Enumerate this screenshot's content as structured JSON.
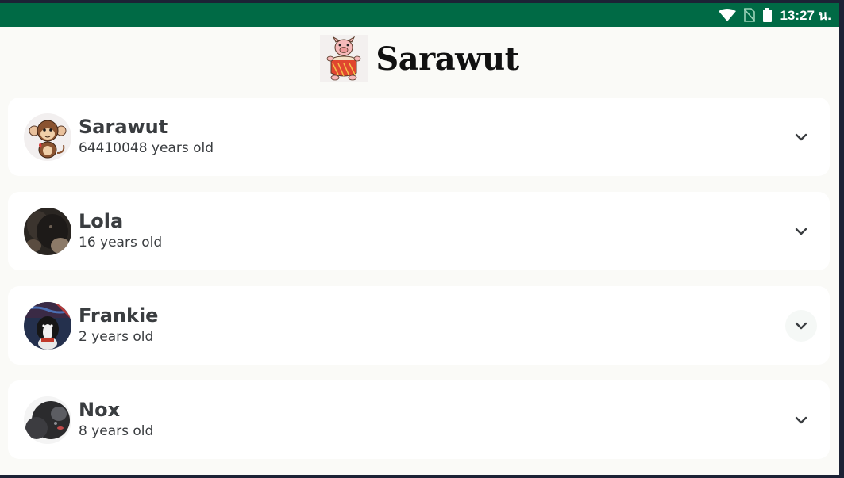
{
  "status_bar": {
    "time": "13:27 น.",
    "icons": [
      "wifi-icon",
      "no-sim-icon",
      "battery-icon"
    ]
  },
  "header": {
    "title": "Sarawut",
    "logo": "pig-drum-logo"
  },
  "pets": [
    {
      "name": "Sarawut",
      "age": "64410048 years old",
      "avatar": "monkey-avatar"
    },
    {
      "name": "Lola",
      "age": "16 years old",
      "avatar": "dog-photo-avatar"
    },
    {
      "name": "Frankie",
      "age": "2 years old",
      "avatar": "dog-photo-avatar"
    },
    {
      "name": "Nox",
      "age": "8 years old",
      "avatar": "dog-photo-avatar"
    }
  ],
  "colors": {
    "status_bar": "#006a45",
    "background": "#fafaf7",
    "card": "#ffffff",
    "text": "#3a3d40"
  }
}
